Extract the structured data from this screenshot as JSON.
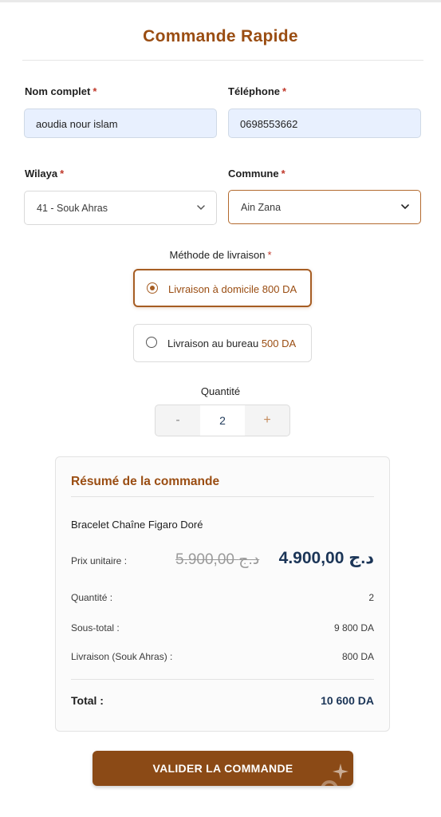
{
  "form": {
    "title": "Commande Rapide",
    "name_label": "Nom complet",
    "name_value": "aoudia nour islam",
    "phone_label": "Téléphone",
    "phone_value": "0698553662",
    "wilaya_label": "Wilaya",
    "wilaya_value": "41 - Souk Ahras",
    "commune_label": "Commune",
    "commune_value": "Ain Zana",
    "required_mark": "*",
    "delivery_label": "Méthode de livraison",
    "delivery_options": [
      {
        "label": "Livraison à domicile",
        "price": "800 DA",
        "selected": true
      },
      {
        "label": "Livraison au bureau",
        "price": "500 DA",
        "selected": false
      }
    ],
    "quantity_label": "Quantité",
    "quantity_minus": "-",
    "quantity_value": "2",
    "quantity_plus": "+"
  },
  "summary": {
    "title": "Résumé de la commande",
    "product": "Bracelet Chaîne Figaro Doré",
    "unit_price_label": "Prix unitaire :",
    "old_price": "5.900,00 د.ج",
    "new_price": "4.900,00 د.ج",
    "quantity_label": "Quantité :",
    "quantity_value": "2",
    "subtotal_label": "Sous-total :",
    "subtotal_value": "9 800 DA",
    "shipping_label": "Livraison (Souk Ahras) :",
    "shipping_value": "800 DA",
    "total_label": "Total :",
    "total_value": "10 600 DA"
  },
  "submit_label": "VALIDER LA COMMANDE",
  "colors": {
    "accent": "#9a4d12",
    "button": "#8b4a16",
    "price": "#1b3557",
    "input_bg": "#e8f0fe"
  }
}
